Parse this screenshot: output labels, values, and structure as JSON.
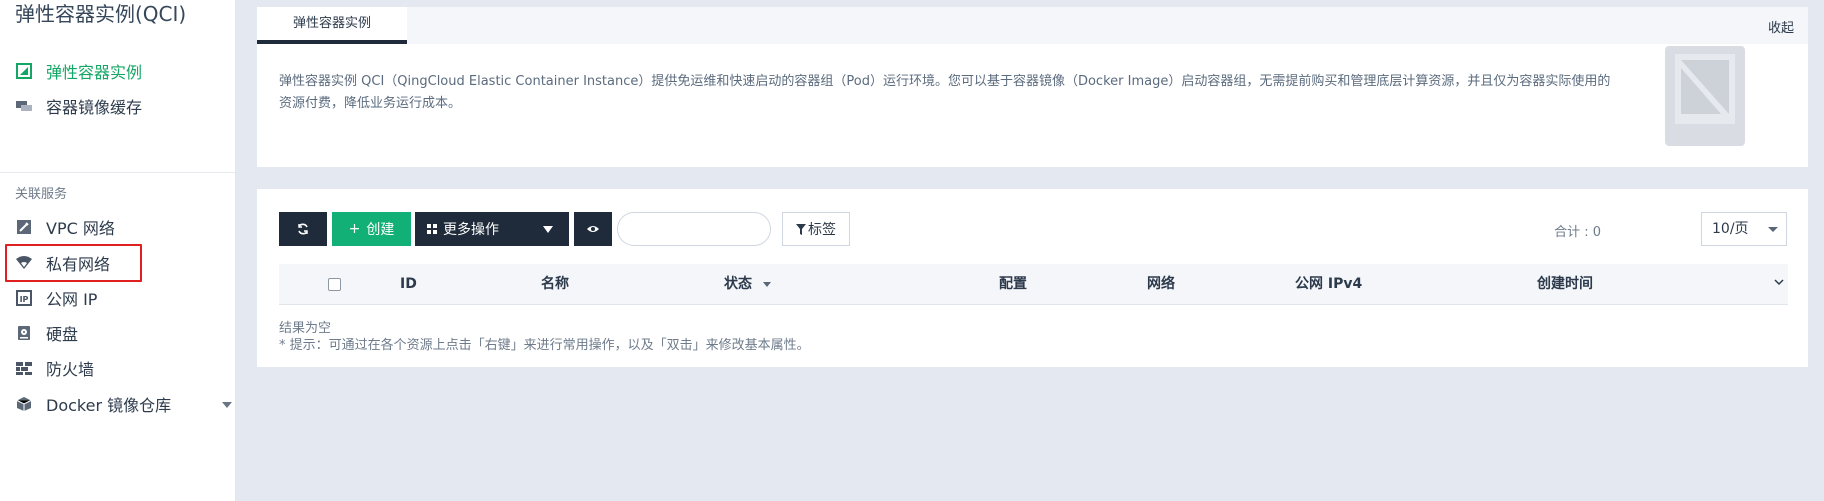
{
  "app": {
    "title": "弹性容器实例(QCI)"
  },
  "sidebar": {
    "items": [
      {
        "label": "弹性容器实例",
        "icon": "container-instance-icon",
        "active": true
      },
      {
        "label": "容器镜像缓存",
        "icon": "image-cache-icon"
      }
    ],
    "related_label": "关联服务",
    "related": [
      {
        "label": "VPC 网络",
        "icon": "vpc-icon"
      },
      {
        "label": "私有网络",
        "icon": "wifi-icon"
      },
      {
        "label": "公网 IP",
        "icon": "ip-icon"
      },
      {
        "label": "硬盘",
        "icon": "disk-icon"
      },
      {
        "label": "防火墙",
        "icon": "firewall-icon"
      },
      {
        "label": "Docker 镜像仓库",
        "icon": "docker-registry-icon"
      }
    ]
  },
  "intro": {
    "tab": "弹性容器实例",
    "collapse": "收起",
    "description": "弹性容器实例 QCI（QingCloud Elastic Container Instance）提供免运维和快速启动的容器组（Pod）运行环境。您可以基于容器镜像（Docker Image）启动容器组，无需提前购买和管理底层计算资源，并且仅为容器实际使用的资源付费，降低业务运行成本。"
  },
  "toolbar": {
    "create": "创建",
    "more": "更多操作",
    "tags": "标签",
    "search_placeholder": ""
  },
  "pagination": {
    "total": "合计 : 0",
    "page_size": "10/页"
  },
  "table": {
    "columns": [
      "ID",
      "名称",
      "状态",
      "配置",
      "网络",
      "公网 IPv4",
      "创建时间"
    ]
  },
  "empty": {
    "text": "结果为空",
    "hint": "* 提示：可通过在各个资源上点击「右键」来进行常用操作，以及「双击」来修改基本属性。"
  },
  "colors": {
    "accent": "#14a664",
    "dark": "#1f2b3a",
    "highlight": "#e02020"
  }
}
